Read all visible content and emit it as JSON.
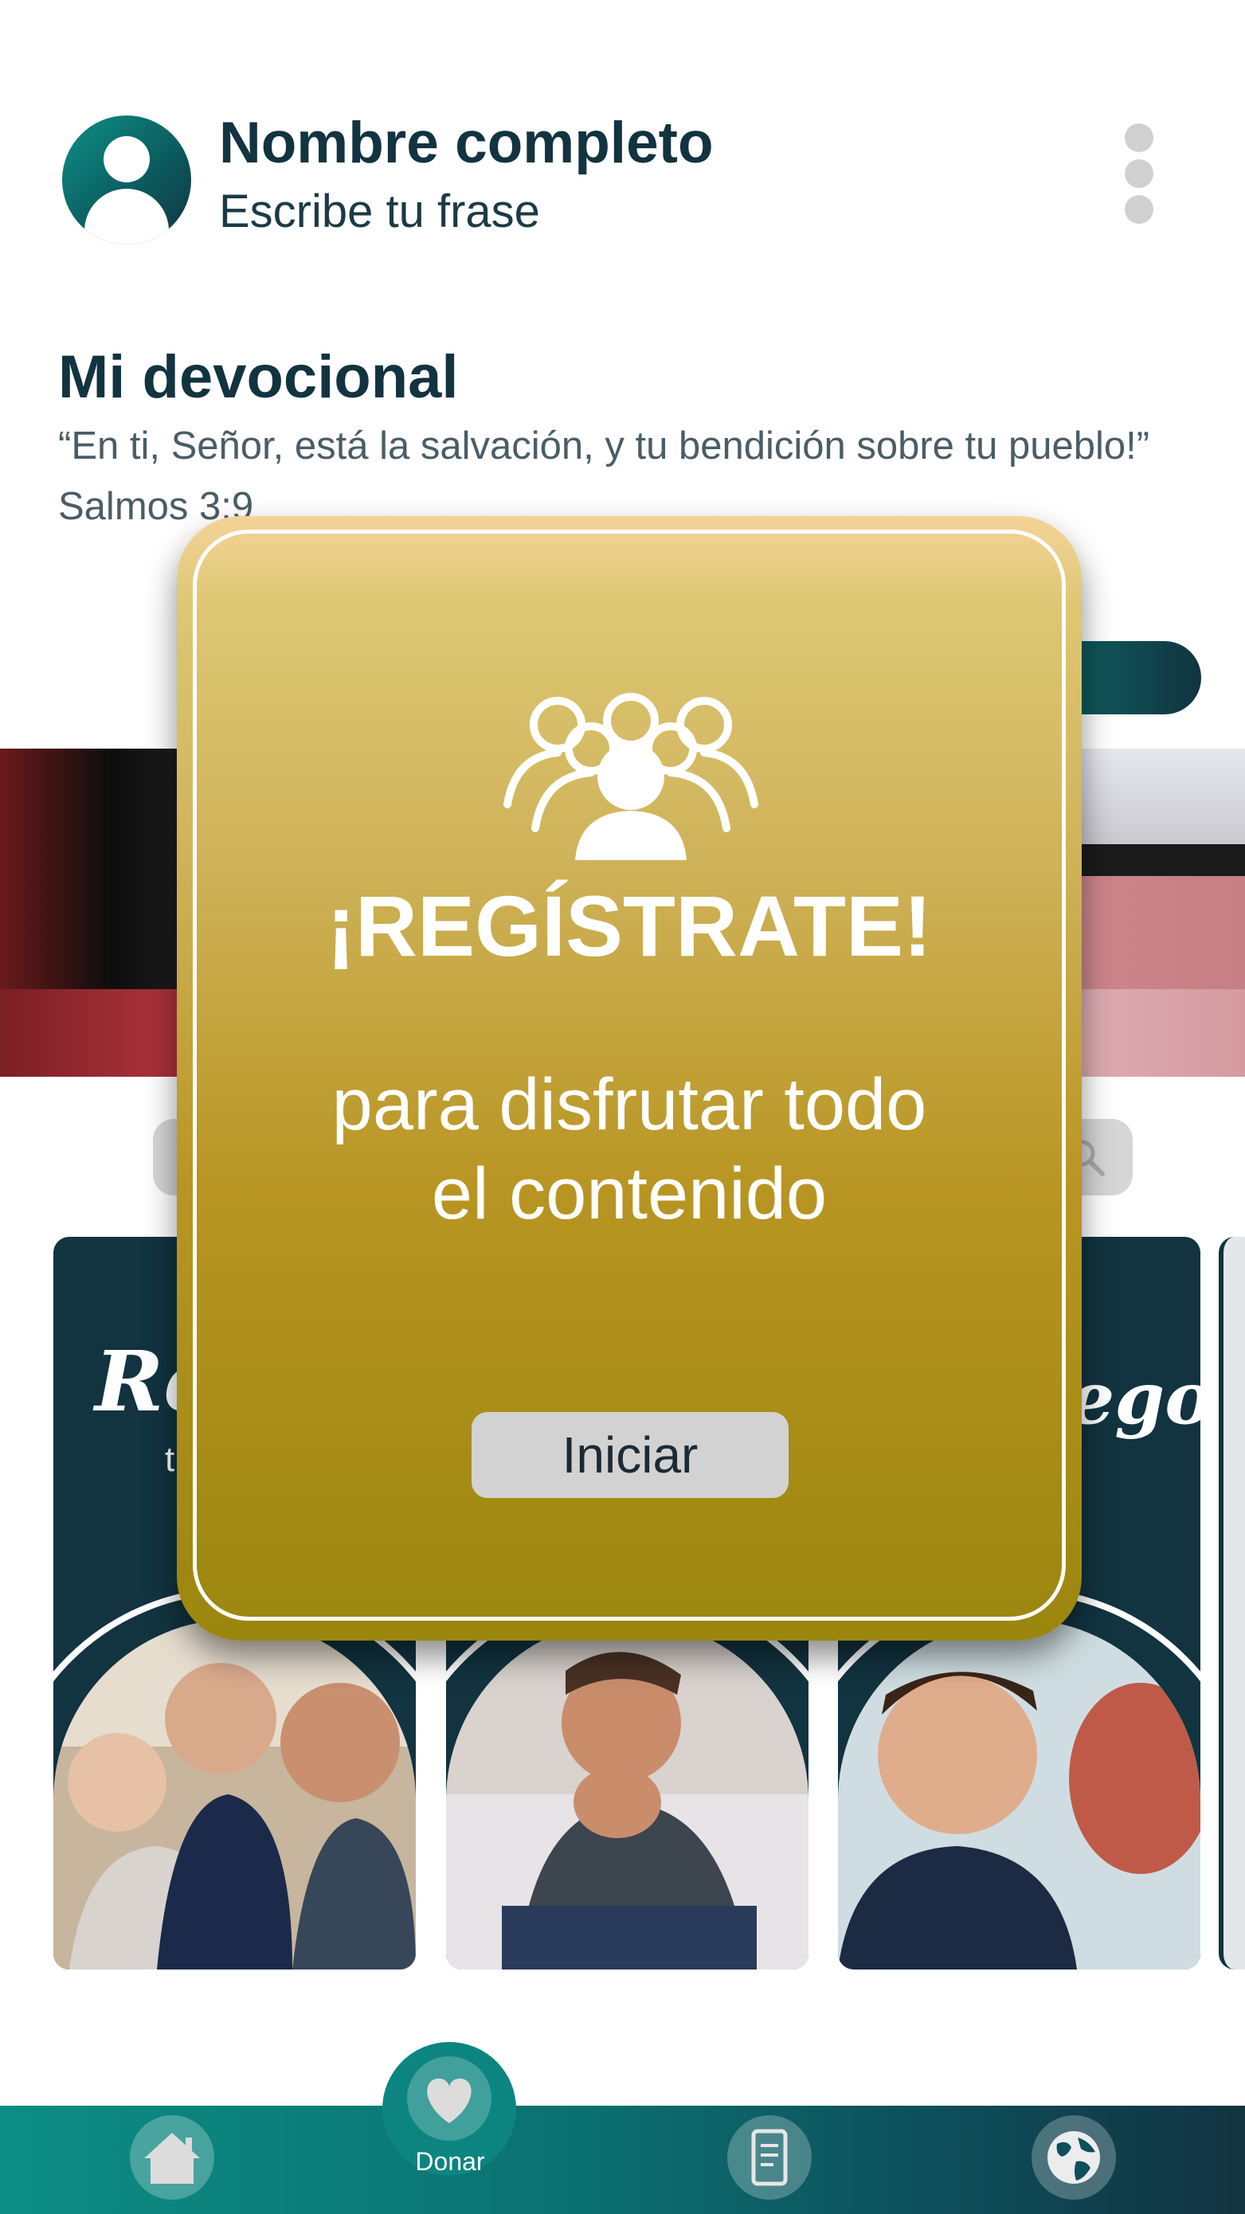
{
  "header": {
    "name": "Nombre completo",
    "phrase": "Escribe tu frase"
  },
  "devotional": {
    "title": "Mi devocional",
    "verse": "“En ti, Señor, está la salvación, y tu bendición sobre tu pueblo!”",
    "reference": "Salmos 3:9"
  },
  "cards": [
    {
      "script_text": "Re",
      "sub_text": "t"
    },
    {
      "script_text": "",
      "sub_text": ""
    },
    {
      "script_text": "ego",
      "sub_text": ""
    }
  ],
  "modal": {
    "title": "¡REGÍSTRATE!",
    "subtitle_line1": "para disfrutar todo",
    "subtitle_line2": "el contenido",
    "button_label": "Iniciar"
  },
  "bottom_nav": {
    "items": [
      {
        "icon": "home-icon"
      },
      {
        "icon": "heart-icon",
        "label": "Donar"
      },
      {
        "icon": "document-icon"
      },
      {
        "icon": "globe-icon"
      }
    ]
  },
  "colors": {
    "primary_dark": "#123340",
    "teal": "#0c8d84",
    "modal_gold": "#b89522"
  }
}
